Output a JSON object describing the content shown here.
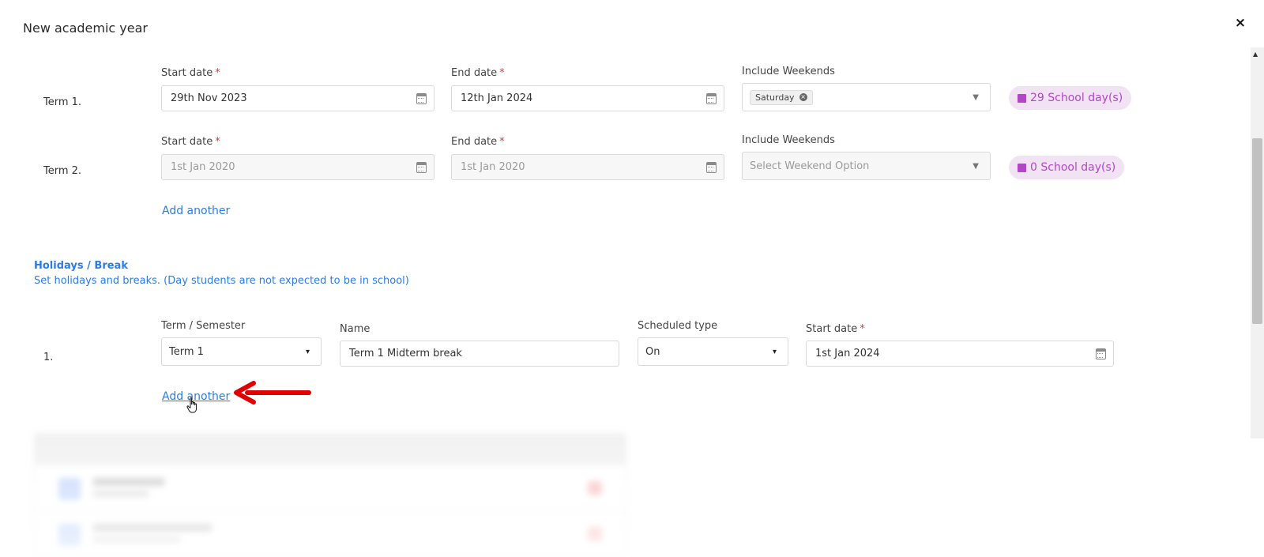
{
  "modal": {
    "title": "New academic year",
    "close_icon": "×"
  },
  "terms": [
    {
      "label": "Term 1.",
      "start_label": "Start date",
      "start_value": "29th Nov 2023",
      "end_label": "End date",
      "end_value": "12th Jan 2024",
      "weekends_label": "Include Weekends",
      "weekend_tag": "Saturday",
      "weekend_placeholder": "",
      "school_days": "29 School day(s)"
    },
    {
      "label": "Term 2.",
      "start_label": "Start date",
      "start_value": "1st Jan 2020",
      "end_label": "End date",
      "end_value": "1st Jan 2020",
      "weekends_label": "Include Weekends",
      "weekend_tag": "",
      "weekend_placeholder": "Select Weekend Option",
      "school_days": "0 School day(s)"
    }
  ],
  "terms_add_another": "Add another",
  "holidays": {
    "title": "Holidays / Break",
    "description": "Set holidays and breaks. (Day students are not expected to be in school)",
    "rows": [
      {
        "label": "1.",
        "term_label": "Term / Semester",
        "term_value": "Term 1",
        "name_label": "Name",
        "name_value": "Term 1 Midterm break",
        "type_label": "Scheduled type",
        "type_value": "On",
        "start_label": "Start date",
        "start_value": "1st Jan 2024"
      }
    ],
    "add_another": "Add another"
  },
  "colors": {
    "accent": "#2a7de1",
    "badge_text": "#b247c6",
    "badge_bg": "#f1e3f3",
    "required": "#e53935",
    "arrow": "#e00000"
  }
}
